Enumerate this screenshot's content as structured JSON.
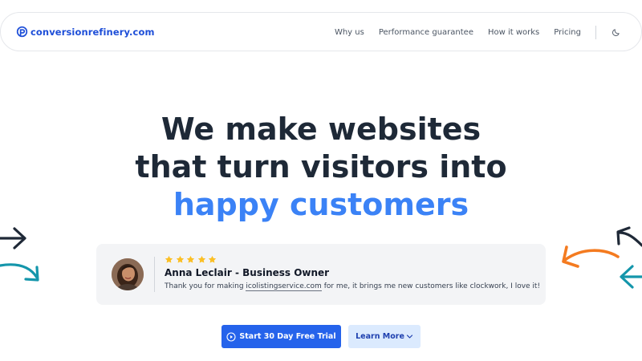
{
  "header": {
    "brand": "conversionrefinery.com",
    "nav": [
      "Why us",
      "Performance guarantee",
      "How it works",
      "Pricing"
    ]
  },
  "hero": {
    "line1": "We make websites",
    "line2": "that turn visitors into",
    "line3": "happy customers"
  },
  "testimonial": {
    "rating": 5,
    "name": "Anna Leclair - Business Owner",
    "quote_before": "Thank you for making ",
    "quote_link": "icolistingservice.com",
    "quote_after": " for me, it brings me new customers like clockwork, I love it!"
  },
  "cta": {
    "primary_label": "Start 30 Day Free Trial",
    "secondary_label": "Learn More"
  },
  "colors": {
    "brand": "#1d4ed8",
    "accent": "#3b82f6",
    "primary_button": "#2563eb",
    "secondary_button": "#dbeafe",
    "star": "#fbbf24",
    "arrow_dark": "#1f2937",
    "arrow_teal": "#1496ab",
    "arrow_orange": "#f47b20"
  }
}
